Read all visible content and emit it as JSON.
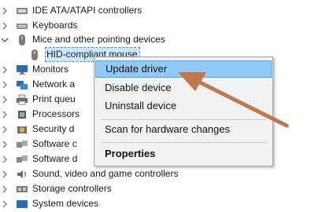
{
  "tree": {
    "items": [
      {
        "label": "IDE ATA/ATAPI controllers",
        "icon": "ide-controller-icon",
        "expanded": false
      },
      {
        "label": "Keyboards",
        "icon": "keyboard-icon",
        "expanded": false
      },
      {
        "label": "Mice and other pointing devices",
        "icon": "mouse-icon",
        "expanded": true
      },
      {
        "label": "HID-compliant mouse",
        "icon": "mouse-icon",
        "selected": true
      },
      {
        "label": "Monitors",
        "icon": "monitor-icon",
        "expanded": false
      },
      {
        "label": "Network a",
        "icon": "network-adapter-icon",
        "expanded": false
      },
      {
        "label": "Print queu",
        "icon": "printer-icon",
        "expanded": false
      },
      {
        "label": "Processors",
        "icon": "processor-icon",
        "expanded": false
      },
      {
        "label": "Security d",
        "icon": "security-device-icon",
        "expanded": false
      },
      {
        "label": "Software c",
        "icon": "software-component-icon",
        "expanded": false
      },
      {
        "label": "Software d",
        "icon": "software-device-icon",
        "expanded": false
      },
      {
        "label": "Sound, video and game controllers",
        "icon": "speaker-icon",
        "expanded": false
      },
      {
        "label": "Storage controllers",
        "icon": "storage-controller-icon",
        "expanded": false
      },
      {
        "label": "System devices",
        "icon": "system-device-icon",
        "expanded": false
      }
    ]
  },
  "context_menu": {
    "update_driver": "Update driver",
    "disable_device": "Disable device",
    "uninstall_device": "Uninstall device",
    "scan_hardware": "Scan for hardware changes",
    "properties": "Properties"
  },
  "colors": {
    "selection": "#cce8ff",
    "menu_hover": "#91c9f7",
    "annotation_arrow": "#c0784a"
  }
}
